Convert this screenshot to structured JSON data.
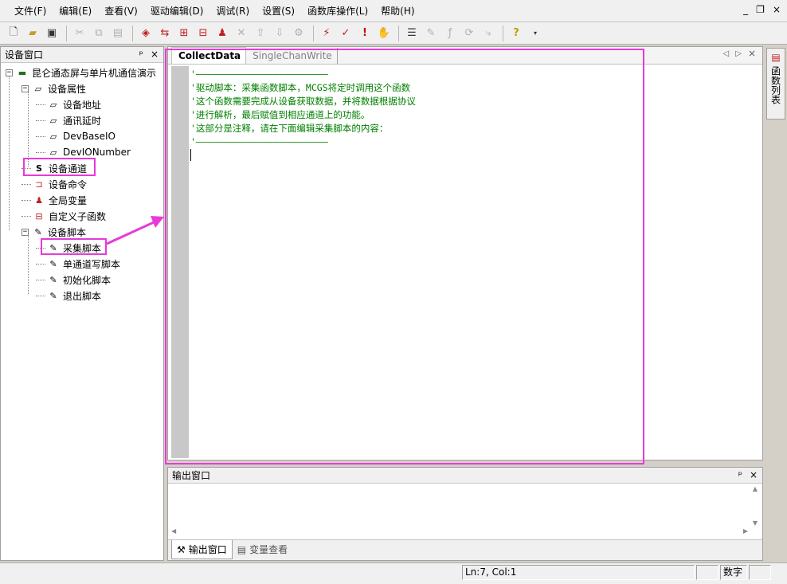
{
  "menu": {
    "items": [
      "文件(F)",
      "编辑(E)",
      "查看(V)",
      "驱动编辑(D)",
      "调试(R)",
      "设置(S)",
      "函数库操作(L)",
      "帮助(H)"
    ],
    "mdi_minimize": "_",
    "mdi_restore": "❐",
    "mdi_close": "×"
  },
  "toolbar": {
    "icons": [
      "new-file-icon",
      "open-folder-icon",
      "save-icon",
      "cut-icon",
      "copy-icon",
      "paste-icon",
      "add-device-icon",
      "add-channel-icon",
      "add-command-icon",
      "add-variable-icon",
      "add-user-icon",
      "delete-icon",
      "move-up-icon",
      "move-down-icon",
      "properties-icon",
      "compile-icon",
      "debug-icon",
      "error-icon",
      "stop-hand-icon",
      "format-icon",
      "edit-icon",
      "function-icon",
      "loop-icon",
      "branch-icon",
      "help-icon"
    ]
  },
  "device_window": {
    "title": "设备窗口",
    "pin": "ᵖ",
    "close": "×",
    "tree": {
      "root": "昆仑通态屏与单片机通信演示",
      "device_properties": "设备属性",
      "device_address": "设备地址",
      "comm_delay": "通讯延时",
      "dev_base_io": "DevBaseIO",
      "dev_io_number": "DevIONumber",
      "device_channel": "设备通道",
      "device_command": "设备命令",
      "global_variable": "全局变量",
      "custom_function": "自定义子函数",
      "device_script": "设备脚本",
      "collect_script": "采集脚本",
      "single_write_script": "单通道写脚本",
      "init_script": "初始化脚本",
      "exit_script": "退出脚本"
    }
  },
  "editor": {
    "tab_active": "CollectData",
    "tab_inactive": "SingleChanWrite",
    "code_lines": [
      "'————————————————————————",
      "'驱动脚本：采集函数脚本，MCGS将定时调用这个函数",
      "'这个函数需要完成从设备获取数据，并将数据根据协议",
      "'进行解析，最后赋值到相应通道上的功能。",
      "'这部分是注释，请在下面编辑采集脚本的内容：",
      "'————————————————————————"
    ]
  },
  "right_tab": {
    "label": "函数列表"
  },
  "output_window": {
    "title": "输出窗口",
    "pin": "ᵖ",
    "close": "×",
    "tab_output": "输出窗口",
    "tab_variables": "变量查看"
  },
  "statusbar": {
    "position": "Ln:7, Col:1",
    "mode": "数字"
  },
  "colors": {
    "highlight": "#e83ad8",
    "code_comment": "#008000"
  }
}
